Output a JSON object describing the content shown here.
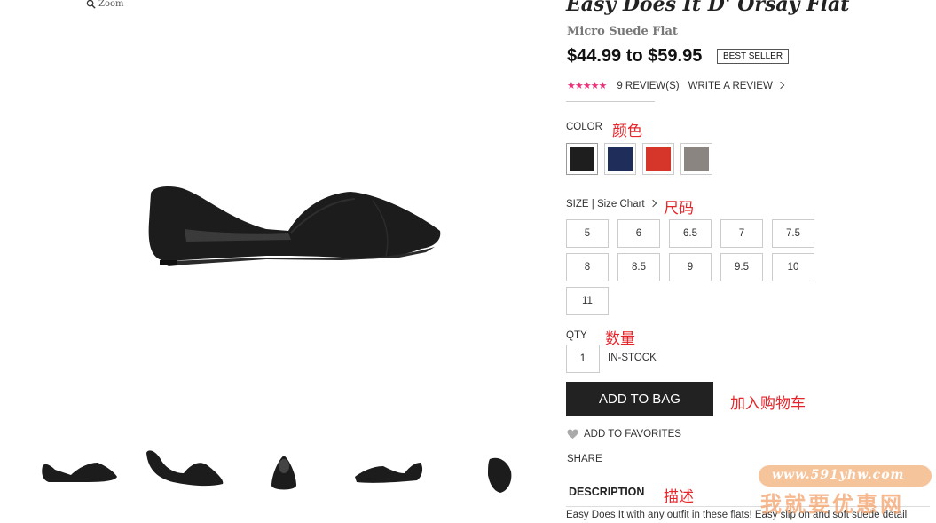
{
  "zoom": {
    "label": "Zoom",
    "icon": "magnifier-icon"
  },
  "product": {
    "title": "Easy Does It D' Orsay Flat",
    "subtitle": "Micro Suede Flat",
    "price": "$44.99 to $59.95",
    "badge": "BEST SELLER",
    "rating": {
      "stars": "★★★★★",
      "value": 4.5,
      "max": 5,
      "reviews_label": "9 REVIEW(S)",
      "write_label": "WRITE A REVIEW"
    }
  },
  "color": {
    "label": "COLOR",
    "annotation": "颜色",
    "swatches": [
      {
        "name": "Black",
        "hex": "#1e1e1e"
      },
      {
        "name": "Navy",
        "hex": "#1f2d5a"
      },
      {
        "name": "Red",
        "hex": "#d6352a"
      },
      {
        "name": "Taupe",
        "hex": "#8a8580"
      }
    ],
    "selected": "Black"
  },
  "size": {
    "label": "SIZE | Size Chart",
    "annotation": "尺码",
    "options": [
      "5",
      "6",
      "6.5",
      "7",
      "7.5",
      "8",
      "8.5",
      "9",
      "9.5",
      "10",
      "11"
    ]
  },
  "qty": {
    "label": "QTY",
    "annotation": "数量",
    "value": "1",
    "status": "IN-STOCK"
  },
  "add_to_bag": {
    "label": "ADD TO BAG",
    "annotation": "加入购物车"
  },
  "favorites": {
    "label": "ADD TO FAVORITES",
    "icon": "heart-icon"
  },
  "share": {
    "label": "SHARE"
  },
  "description": {
    "heading": "DESCRIPTION",
    "annotation": "描述",
    "text": "Easy Does It with any outfit in these flats! Easy slip on and soft suede detail"
  },
  "watermark": {
    "url": "www.591yhw.com",
    "text": "我就要优惠网"
  },
  "colors": {
    "accent_pink": "#e8337a",
    "annotation_red": "#e5252a",
    "button_dark": "#222222",
    "watermark_orange": "#f4a16a"
  }
}
